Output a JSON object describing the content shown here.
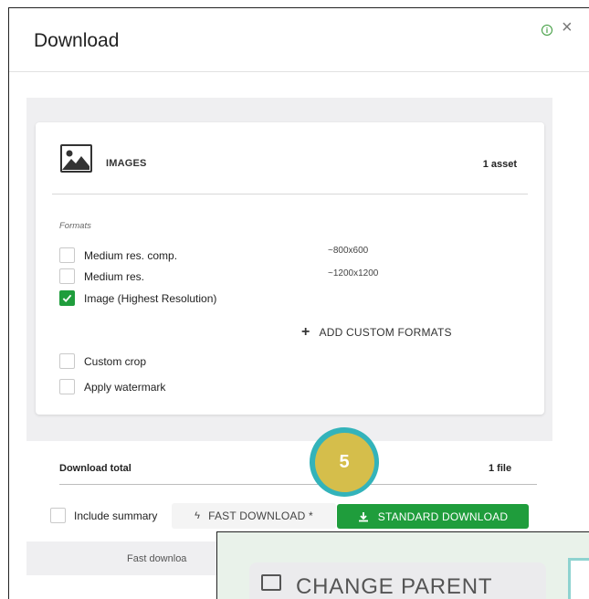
{
  "dialog": {
    "title": "Download",
    "info_icon": "info-icon",
    "close_icon": "close-icon",
    "close_glyph": "×",
    "info_glyph": "i"
  },
  "card": {
    "section_icon": "image-icon",
    "section_label": "IMAGES",
    "asset_count": "1 asset",
    "formats_label": "Formats",
    "formats": [
      {
        "label": "Medium res. comp.",
        "size": "~800x600",
        "checked": false
      },
      {
        "label": "Medium res.",
        "size": "~1200x1200",
        "checked": false
      },
      {
        "label": "Image (Highest Resolution)",
        "size": "",
        "checked": true
      }
    ],
    "add_custom_label": "ADD CUSTOM FORMATS",
    "add_custom_glyph": "+",
    "options": [
      {
        "label": "Custom crop",
        "checked": false
      },
      {
        "label": "Apply watermark",
        "checked": false
      }
    ]
  },
  "total": {
    "label": "Download total",
    "value": "1 file"
  },
  "actions": {
    "include_summary_label": "Include summary",
    "fast_download_label": "FAST DOWNLOAD *",
    "fast_download_glyph": "ϟ",
    "standard_download_label": "STANDARD DOWNLOAD"
  },
  "footer": {
    "text": "Fast downloa"
  },
  "overlay": {
    "button_label": "CHANGE PARENT"
  },
  "step_badge": {
    "number": "5"
  },
  "colors": {
    "accent_green": "#1f9d3c",
    "badge_ring": "#33b3ba",
    "badge_fill": "#d5be4b"
  }
}
